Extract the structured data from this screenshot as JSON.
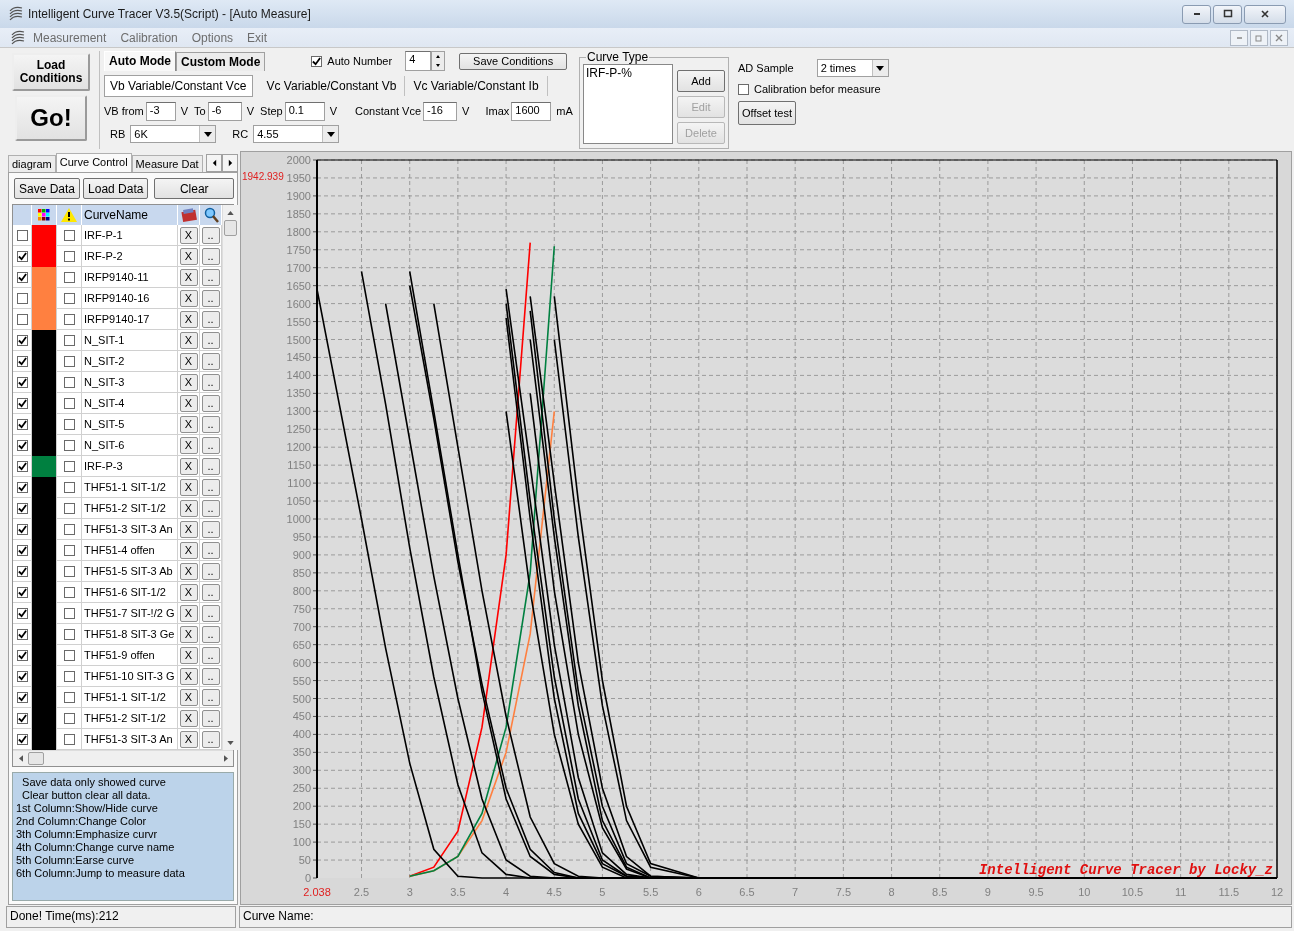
{
  "window": {
    "title": "Intelligent Curve Tracer V3.5(Script) - [Auto Measure]"
  },
  "menu": [
    "Measurement",
    "Calibration",
    "Options",
    "Exit"
  ],
  "toolbar": {
    "load_button": "Load Conditions",
    "go_button": "Go!",
    "mode_tabs": [
      {
        "label": "Auto Mode",
        "selected": true
      },
      {
        "label": "Custom Mode",
        "selected": false
      }
    ],
    "auto_number": {
      "label": "Auto Number",
      "checked": true,
      "value": "4"
    },
    "save_conditions": "Save Conditions",
    "sub_tabs": [
      {
        "label": "Vb Variable/Constant Vce",
        "selected": true
      },
      {
        "label": "Vc Variable/Constant Vb",
        "selected": false
      },
      {
        "label": "Vc Variable/Constant Ib",
        "selected": false
      }
    ],
    "params": [
      {
        "label": "VB from",
        "value": "-3",
        "unit": "V"
      },
      {
        "label": "To",
        "value": "-6",
        "unit": "V"
      },
      {
        "label": "Step",
        "value": "0.1",
        "unit": "V"
      },
      {
        "label": "Constant Vce",
        "value": "-16",
        "unit": "V"
      },
      {
        "label": "Imax",
        "value": "1600",
        "unit": "mA"
      }
    ],
    "dropdowns": [
      {
        "label": "RB",
        "value": "6K"
      },
      {
        "label": "RC",
        "value": "4.55"
      }
    ],
    "curve_type": {
      "title": "Curve Type",
      "items": [
        "IRF-P-%"
      ],
      "buttons": [
        {
          "label": "Add",
          "disabled": false
        },
        {
          "label": "Edit",
          "disabled": true
        },
        {
          "label": "Delete",
          "disabled": true
        }
      ]
    },
    "ad_sample": {
      "label": "AD Sample",
      "value": "2 times"
    },
    "calibration": {
      "label": "Calibration befor measure",
      "checked": false
    },
    "offset_test": "Offset test"
  },
  "panel_tabs": [
    {
      "label": "diagram",
      "selected": false
    },
    {
      "label": "Curve Control",
      "selected": true
    },
    {
      "label": "Measure Dat",
      "selected": false
    }
  ],
  "data_buttons": [
    "Save Data",
    "Load Data",
    "Clear"
  ],
  "curves": {
    "name_column": "CurveName",
    "rows": [
      {
        "show": false,
        "color": "#ff0000",
        "emphasize": false,
        "name": "IRF-P-1",
        "erase": "X",
        "jump": ".."
      },
      {
        "show": true,
        "color": "#ff0000",
        "emphasize": false,
        "name": "IRF-P-2",
        "erase": "X",
        "jump": ".."
      },
      {
        "show": true,
        "color": "#ff8040",
        "emphasize": false,
        "name": "IRFP9140-11",
        "erase": "X",
        "jump": ".."
      },
      {
        "show": false,
        "color": "#ff8040",
        "emphasize": false,
        "name": "IRFP9140-16",
        "erase": "X",
        "jump": ".."
      },
      {
        "show": false,
        "color": "#ff8040",
        "emphasize": false,
        "name": "IRFP9140-17",
        "erase": "X",
        "jump": ".."
      },
      {
        "show": true,
        "color": "#000000",
        "emphasize": false,
        "name": "N_SIT-1",
        "erase": "X",
        "jump": ".."
      },
      {
        "show": true,
        "color": "#000000",
        "emphasize": false,
        "name": "N_SIT-2",
        "erase": "X",
        "jump": ".."
      },
      {
        "show": true,
        "color": "#000000",
        "emphasize": false,
        "name": "N_SIT-3",
        "erase": "X",
        "jump": ".."
      },
      {
        "show": true,
        "color": "#000000",
        "emphasize": false,
        "name": "N_SIT-4",
        "erase": "X",
        "jump": ".."
      },
      {
        "show": true,
        "color": "#000000",
        "emphasize": false,
        "name": "N_SIT-5",
        "erase": "X",
        "jump": ".."
      },
      {
        "show": true,
        "color": "#000000",
        "emphasize": false,
        "name": "N_SIT-6",
        "erase": "X",
        "jump": ".."
      },
      {
        "show": true,
        "color": "#008040",
        "emphasize": false,
        "name": "IRF-P-3",
        "erase": "X",
        "jump": ".."
      },
      {
        "show": true,
        "color": "#000000",
        "emphasize": false,
        "name": "THF51-1 SIT-1/2",
        "erase": "X",
        "jump": ".."
      },
      {
        "show": true,
        "color": "#000000",
        "emphasize": false,
        "name": "THF51-2 SIT-1/2",
        "erase": "X",
        "jump": ".."
      },
      {
        "show": true,
        "color": "#000000",
        "emphasize": false,
        "name": "THF51-3 SIT-3 An",
        "erase": "X",
        "jump": ".."
      },
      {
        "show": true,
        "color": "#000000",
        "emphasize": false,
        "name": "THF51-4 offen",
        "erase": "X",
        "jump": ".."
      },
      {
        "show": true,
        "color": "#000000",
        "emphasize": false,
        "name": "THF51-5 SIT-3 Ab",
        "erase": "X",
        "jump": ".."
      },
      {
        "show": true,
        "color": "#000000",
        "emphasize": false,
        "name": "THF51-6 SIT-1/2",
        "erase": "X",
        "jump": ".."
      },
      {
        "show": true,
        "color": "#000000",
        "emphasize": false,
        "name": "THF51-7 SIT-!/2 G",
        "erase": "X",
        "jump": ".."
      },
      {
        "show": true,
        "color": "#000000",
        "emphasize": false,
        "name": "THF51-8 SIT-3 Ge",
        "erase": "X",
        "jump": ".."
      },
      {
        "show": true,
        "color": "#000000",
        "emphasize": false,
        "name": "THF51-9 offen",
        "erase": "X",
        "jump": ".."
      },
      {
        "show": true,
        "color": "#000000",
        "emphasize": false,
        "name": "THF51-10 SIT-3 G",
        "erase": "X",
        "jump": ".."
      },
      {
        "show": true,
        "color": "#000000",
        "emphasize": false,
        "name": "THF51-1 SIT-1/2",
        "erase": "X",
        "jump": ".."
      },
      {
        "show": true,
        "color": "#000000",
        "emphasize": false,
        "name": "THF51-2 SIT-1/2",
        "erase": "X",
        "jump": ".."
      },
      {
        "show": true,
        "color": "#000000",
        "emphasize": false,
        "name": "THF51-3 SIT-3 An",
        "erase": "X",
        "jump": ".."
      }
    ]
  },
  "help_text": [
    "  Save data only showed curve",
    "  Clear button clear all data.",
    "1st Column:Show/Hide curve",
    "2nd Column:Change Color",
    "3th Column:Emphasize curvr",
    "4th Column:Change curve name",
    "5th Column:Earse curve",
    "6th Column:Jump to measure data"
  ],
  "chart": {
    "chart_data": {
      "type": "line",
      "grid": true,
      "x": [
        2.038,
        2.5,
        2.75,
        3,
        3.25,
        3.5,
        3.75,
        4,
        4.25,
        4.5,
        4.75,
        5,
        5.25,
        5.5,
        6,
        12
      ],
      "series": [
        {
          "color": "#ff0000",
          "values": [
            null,
            null,
            null,
            5,
            30,
            130,
            420,
            900,
            1770,
            null,
            null,
            null,
            null,
            null,
            null,
            null
          ]
        },
        {
          "color": "#ff8040",
          "values": [
            null,
            null,
            null,
            5,
            20,
            60,
            160,
            350,
            680,
            1300,
            null,
            null,
            null,
            null,
            null,
            null
          ]
        },
        {
          "color": "#008040",
          "values": [
            null,
            null,
            null,
            5,
            20,
            60,
            180,
            420,
            850,
            1760,
            null,
            null,
            null,
            null,
            null,
            null
          ]
        },
        {
          "color": "#000000",
          "values": [
            1640,
            1000,
            640,
            320,
            80,
            5,
            0,
            0,
            0,
            0,
            0,
            0,
            0,
            0,
            0,
            0
          ]
        },
        {
          "color": "#000000",
          "values": [
            null,
            1690,
            1320,
            920,
            560,
            260,
            70,
            10,
            0,
            0,
            0,
            0,
            0,
            0,
            0,
            0
          ]
        },
        {
          "color": "#000000",
          "values": [
            null,
            null,
            1600,
            1220,
            840,
            500,
            220,
            50,
            5,
            0,
            0,
            0,
            0,
            0,
            0,
            0
          ]
        },
        {
          "color": "#000000",
          "values": [
            null,
            null,
            null,
            1690,
            1300,
            900,
            520,
            220,
            60,
            10,
            0,
            0,
            0,
            0,
            0,
            0
          ]
        },
        {
          "color": "#000000",
          "values": [
            null,
            null,
            null,
            1650,
            1280,
            880,
            540,
            250,
            80,
            15,
            0,
            0,
            0,
            0,
            0,
            0
          ]
        },
        {
          "color": "#000000",
          "values": [
            null,
            null,
            null,
            null,
            1600,
            1200,
            800,
            450,
            170,
            40,
            5,
            0,
            0,
            0,
            0,
            0
          ]
        },
        {
          "color": "#000000",
          "values": [
            null,
            null,
            null,
            null,
            null,
            null,
            null,
            1640,
            1150,
            650,
            280,
            70,
            10,
            0,
            0,
            0
          ]
        },
        {
          "color": "#000000",
          "values": [
            null,
            null,
            null,
            null,
            null,
            null,
            null,
            1600,
            1050,
            560,
            220,
            50,
            5,
            0,
            0,
            0
          ]
        },
        {
          "color": "#000000",
          "values": [
            null,
            null,
            null,
            null,
            null,
            null,
            null,
            1560,
            1000,
            500,
            180,
            40,
            5,
            0,
            0,
            0
          ]
        },
        {
          "color": "#000000",
          "values": [
            null,
            null,
            null,
            null,
            null,
            null,
            null,
            null,
            1620,
            1100,
            600,
            250,
            60,
            5,
            0,
            0
          ]
        },
        {
          "color": "#000000",
          "values": [
            null,
            null,
            null,
            null,
            null,
            null,
            null,
            null,
            1580,
            1000,
            520,
            200,
            40,
            5,
            0,
            0
          ]
        },
        {
          "color": "#000000",
          "values": [
            null,
            null,
            null,
            null,
            null,
            null,
            null,
            null,
            1500,
            950,
            480,
            160,
            30,
            0,
            0,
            0
          ]
        },
        {
          "color": "#000000",
          "values": [
            null,
            null,
            null,
            null,
            null,
            null,
            null,
            null,
            null,
            1620,
            1050,
            550,
            200,
            40,
            0,
            0
          ]
        },
        {
          "color": "#000000",
          "values": [
            null,
            null,
            null,
            null,
            null,
            null,
            null,
            null,
            null,
            1500,
            950,
            480,
            160,
            30,
            0,
            0
          ]
        },
        {
          "color": "#000000",
          "values": [
            null,
            null,
            null,
            null,
            null,
            null,
            null,
            1300,
            800,
            400,
            150,
            30,
            0,
            0,
            0,
            0
          ]
        },
        {
          "color": "#000000",
          "values": [
            null,
            null,
            null,
            null,
            null,
            null,
            null,
            null,
            1350,
            800,
            400,
            140,
            25,
            0,
            0,
            0
          ]
        }
      ],
      "xlim": [
        2.038,
        12
      ],
      "ylim": [
        0,
        2000
      ],
      "xticks": [
        {
          "value": 2.038,
          "label": "2.038"
        },
        2.5,
        3,
        3.5,
        4,
        4.5,
        5,
        5.5,
        6,
        6.5,
        7,
        7.5,
        8,
        8.5,
        9,
        9.5,
        10,
        10.5,
        11,
        11.5,
        12
      ],
      "yticks": [
        0,
        50,
        100,
        150,
        200,
        250,
        300,
        350,
        400,
        450,
        500,
        550,
        600,
        650,
        700,
        750,
        800,
        850,
        900,
        950,
        1000,
        1050,
        1100,
        1150,
        1200,
        1250,
        1300,
        1350,
        1400,
        1450,
        1500,
        1550,
        1600,
        1650,
        1700,
        1750,
        1800,
        1850,
        1900,
        1950,
        2000
      ],
      "annotations": [
        "1942.939",
        "Intelligent Curve Tracer by Locky_z"
      ]
    }
  },
  "status_bar": [
    "Done!  Time(ms):212",
    "Curve Name:"
  ]
}
